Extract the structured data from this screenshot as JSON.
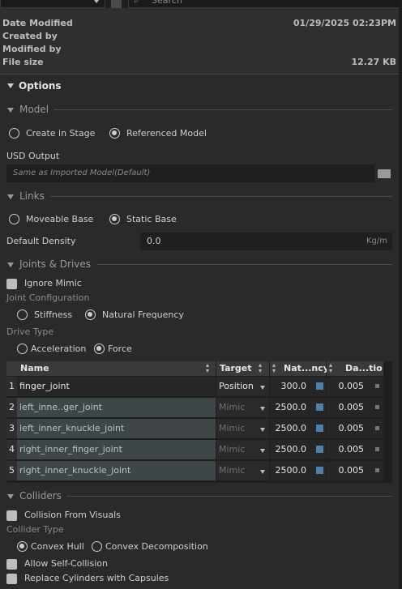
{
  "top": {
    "search_placeholder": "Search"
  },
  "info": {
    "rows": [
      {
        "label": "Date Modified",
        "value": "01/29/2025 02:23PM"
      },
      {
        "label": "Created by",
        "value": ""
      },
      {
        "label": "Modified by",
        "value": ""
      },
      {
        "label": "File size",
        "value": "12.27 KB"
      }
    ]
  },
  "options": {
    "title": "Options"
  },
  "model": {
    "title": "Model",
    "create_in_stage": "Create in Stage",
    "referenced_model": "Referenced Model",
    "usd_output_label": "USD Output",
    "usd_output_placeholder": "Same as Imported Model(Default)"
  },
  "links": {
    "title": "Links",
    "moveable_base": "Moveable Base",
    "static_base": "Static Base",
    "default_density_label": "Default Density",
    "default_density_value": "0.0",
    "density_unit": "Kg/m"
  },
  "joints": {
    "title": "Joints & Drives",
    "ignore_mimic": "Ignore Mimic",
    "joint_config_label": "Joint Configuration",
    "stiffness": "Stiffness",
    "natural_frequency": "Natural Frequency",
    "drive_type_label": "Drive Type",
    "acceleration": "Acceleration",
    "force": "Force",
    "columns": [
      "Name",
      "Target",
      "Nat...ncy",
      "Da...tio"
    ],
    "rows": [
      {
        "n": "1",
        "name": "finger_joint",
        "target": "Position",
        "nat": "300.0",
        "damp": "0.005"
      },
      {
        "n": "2",
        "name": "left_inne..ger_joint",
        "target": "Mimic",
        "nat": "2500.0",
        "damp": "0.005"
      },
      {
        "n": "3",
        "name": "left_inner_knuckle_joint",
        "target": "Mimic",
        "nat": "2500.0",
        "damp": "0.005"
      },
      {
        "n": "4",
        "name": "right_inner_finger_joint",
        "target": "Mimic",
        "nat": "2500.0",
        "damp": "0.005"
      },
      {
        "n": "5",
        "name": "right_inner_knuckle_joint",
        "target": "Mimic",
        "nat": "2500.0",
        "damp": "0.005"
      }
    ]
  },
  "colliders": {
    "title": "Colliders",
    "collision_from_visuals": "Collision From Visuals",
    "collider_type_label": "Collider Type",
    "convex_hull": "Convex Hull",
    "convex_decomposition": "Convex Decomposition",
    "allow_self_collision": "Allow Self-Collision",
    "replace_cylinders": "Replace Cylinders with Capsules"
  }
}
